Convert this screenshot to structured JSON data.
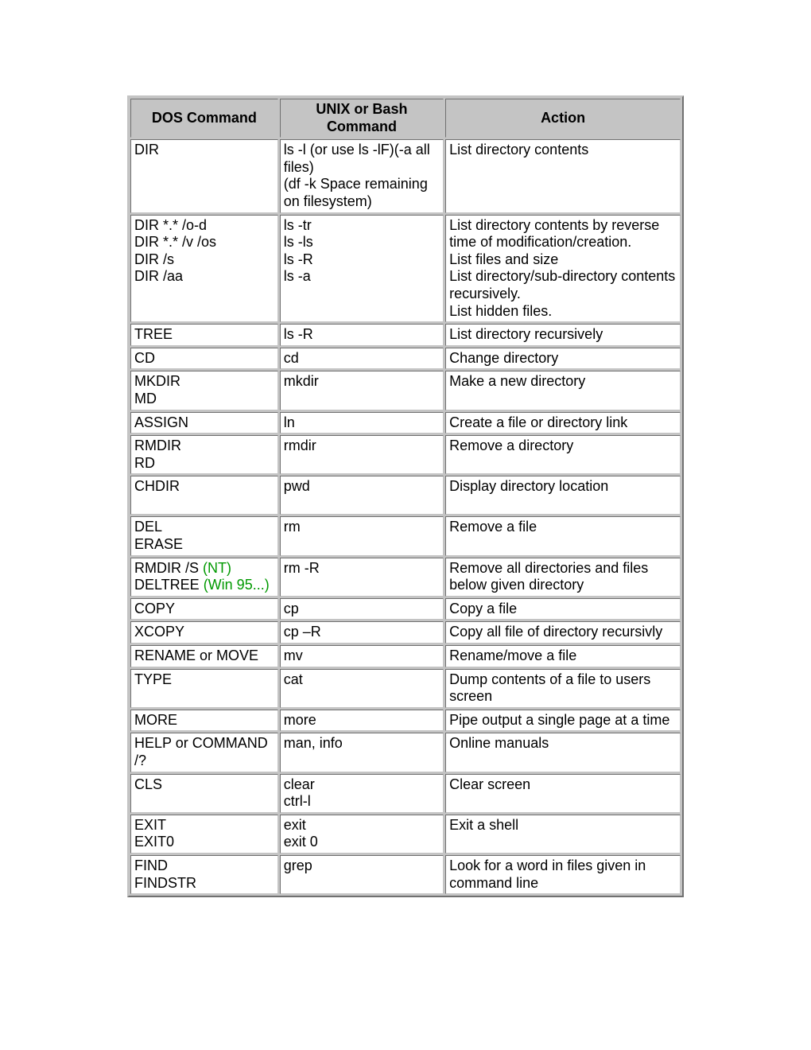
{
  "headers": {
    "dos": "DOS Command",
    "unix": "UNIX or Bash Command",
    "action": "Action"
  },
  "rows": [
    {
      "dos_html": "DIR",
      "unix_html": "ls -l (or use ls -lF)(-a all files)<br>(df -k Space remaining on filesystem)",
      "action_html": "List directory contents",
      "action_vmid": true
    },
    {
      "dos_html": "DIR *.* /o-d<br>DIR *.* /v /os<br>DIR /s<br>DIR /aa",
      "unix_html": "ls -tr<br>ls -ls<br>ls -R<br>ls -a",
      "action_html": "List directory contents by reverse time of modification/creation.<br>List files and size<br>List directory/sub-directory contents recursively.<br>List hidden files."
    },
    {
      "dos_html": "TREE",
      "unix_html": "ls -R",
      "action_html": "List directory recursively"
    },
    {
      "dos_html": "CD",
      "unix_html": "cd",
      "action_html": "Change directory"
    },
    {
      "dos_html": "MKDIR<br>MD",
      "unix_html": "mkdir",
      "action_html": "Make a new directory",
      "action_vmid": true
    },
    {
      "dos_html": "ASSIGN",
      "unix_html": "ln",
      "action_html": "Create a file or directory link"
    },
    {
      "dos_html": "RMDIR<br>RD",
      "unix_html": "rmdir",
      "action_html": "Remove a directory",
      "unix_vmid": true,
      "action_vmid": true
    },
    {
      "dos_html": "CHDIR",
      "unix_html": "pwd<br>&nbsp;",
      "action_html": "Display directory location",
      "dos_vmid": true,
      "action_vmid": true
    },
    {
      "dos_html": "DEL<br>ERASE",
      "unix_html": "rm",
      "action_html": "Remove a file",
      "unix_vmid": true,
      "action_vmid": true
    },
    {
      "dos_html": "RMDIR /S <span class=\"green\">(NT)</span><br>DELTREE <span class=\"green\">(Win 95...)</span>",
      "unix_html": "rm -R",
      "action_html": "Remove all directories and files below given directory",
      "unix_vmid": true
    },
    {
      "dos_html": "COPY",
      "unix_html": "cp",
      "action_html": "Copy a file"
    },
    {
      "dos_html": "XCOPY",
      "unix_html": "cp –R",
      "action_html": "Copy all file of directory recursivly"
    },
    {
      "dos_html": "RENAME or MOVE",
      "unix_html": "mv",
      "action_html": "Rename/move a file"
    },
    {
      "dos_html": "TYPE",
      "unix_html": "cat",
      "action_html": "Dump contents of a file to users screen",
      "dos_vmid": true,
      "unix_vmid": true
    },
    {
      "dos_html": "MORE",
      "unix_html": "more",
      "action_html": "Pipe output a single page at a time",
      "dos_vmid": true,
      "unix_vmid": true
    },
    {
      "dos_html": "HELP or COMMAND /?",
      "unix_html": "man, info",
      "action_html": "Online manuals",
      "unix_vmid": true,
      "action_vmid": true
    },
    {
      "dos_html": "CLS",
      "unix_html": "clear<br>ctrl-l",
      "action_html": "Clear screen",
      "dos_vmid": true,
      "action_vmid": true
    },
    {
      "dos_html": "EXIT<br>EXIT0",
      "unix_html": "exit<br>exit 0",
      "action_html": "Exit a shell"
    },
    {
      "dos_html": "FIND<br>FINDSTR",
      "unix_html": "grep",
      "action_html": "Look for a word in files given in command line",
      "unix_vmid": true
    }
  ]
}
